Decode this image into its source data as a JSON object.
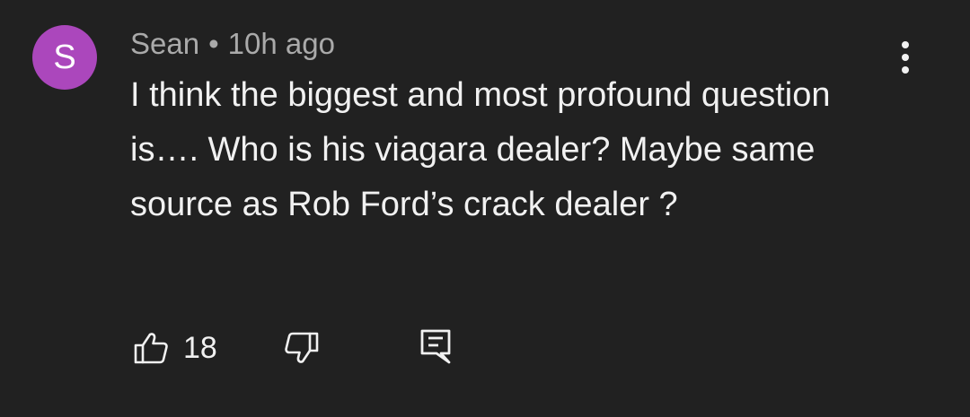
{
  "comment": {
    "avatar_letter": "S",
    "avatar_color": "#ab47bc",
    "author": "Sean",
    "separator": "•",
    "timestamp": "10h ago",
    "text": "I think the biggest and most profound question is…. Who is his viagara dealer? Maybe same source as Rob Ford’s crack dealer ?",
    "like_count": "18",
    "icons": {
      "menu": "more-vert-icon",
      "like": "thumbs-up-icon",
      "dislike": "thumbs-down-icon",
      "reply": "reply-comment-icon"
    }
  },
  "colors": {
    "background": "#212121",
    "text_primary": "#f1f1f1",
    "text_secondary": "#aaaaaa"
  }
}
